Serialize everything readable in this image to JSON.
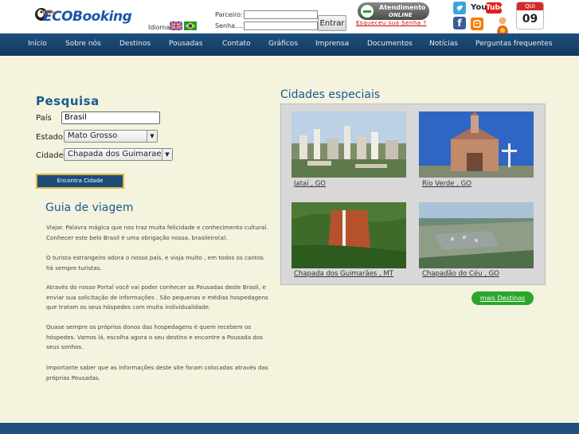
{
  "header": {
    "logo_text": "ECOBooking",
    "idioma_label": "Idioma:",
    "parceiro_label": "Parceiro:",
    "senha_label": "Senha....:",
    "entrar_label": "Entrar",
    "atendimento_line1": "Atendimento",
    "atendimento_line2": "ONLINE",
    "esqueceu_label": "Esqueceu sua Senha ?",
    "youtube_you": "You",
    "youtube_tube": "Tube",
    "calendar_month": "QUI",
    "calendar_day": "09"
  },
  "nav": {
    "items": [
      "Início",
      "Sobre nós",
      "Destinos",
      "Pousadas",
      "Contato",
      "Gráficos",
      "Imprensa",
      "Documentos",
      "Notícias",
      "Perguntas frequentes"
    ]
  },
  "search": {
    "title": "Pesquisa",
    "pais_label": "País",
    "pais_value": "Brasil",
    "estado_label": "Estado",
    "estado_value": "Mato Grosso",
    "cidade_label": "Cidade",
    "cidade_value": "Chapada dos Guimaraes",
    "button_label": "Encontra Cidade"
  },
  "guide": {
    "title": "Guia de viagem",
    "paragraphs": [
      "Viajar. Palavra mágica que nos traz muita felicidade e conhecimento cultural. Conhecer este belo Brasil é uma obrigação nossa, brasileiro(a).",
      "O turista estrangeiro adora o nosso país, e viaja muito , em todos os cantos há sempre turistas.",
      "Através do nosso Portal você vai poder conhecer as Pousadas deste Brasil, e enviar sua solicitação de informações . São pequenas e médias hospedagens que tratam os seus hóspedes com muita individualidade.",
      "Quase sempre os próprios donos das hospedagens é quem recebem os hóspedes. Vamos lá, escolha agora o seu destino e encontre a Pousada dos seus sonhos.",
      "Importante saber que as informações deste site foram colocadas através das próprias Pousadas."
    ]
  },
  "cities": {
    "title": "Cidades especiais",
    "items": [
      "Jataí , GO",
      "Rio Verde , GO",
      "Chapada dos Guimarães , MT",
      "Chapadão do Céu , GO"
    ],
    "more_label": "mais Destinos"
  }
}
